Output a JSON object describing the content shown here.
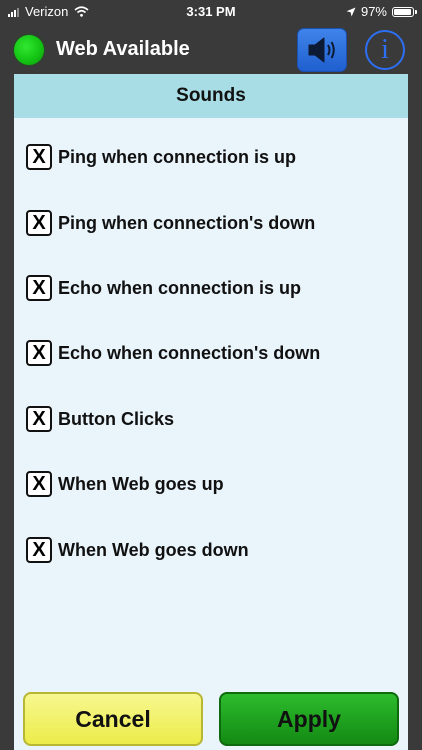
{
  "status_bar": {
    "carrier": "Verizon",
    "time": "3:31 PM",
    "battery": "97%",
    "battery_level": 0.97,
    "icons": [
      "signal-bars-icon",
      "wifi-icon",
      "location-arrow-icon",
      "battery-icon"
    ]
  },
  "header": {
    "title": "Web Available",
    "status_color": "#1ed51e",
    "sound_icon": "speaker-icon",
    "info_label": "i"
  },
  "panel": {
    "title": "Sounds",
    "options": [
      {
        "label": "Ping when connection is up",
        "checked": true,
        "mark": "X"
      },
      {
        "label": "Ping when connection's down",
        "checked": true,
        "mark": "X"
      },
      {
        "label": "Echo when connection is up",
        "checked": true,
        "mark": "X"
      },
      {
        "label": "Echo when connection's down",
        "checked": true,
        "mark": "X"
      },
      {
        "label": "Button Clicks",
        "checked": true,
        "mark": "X"
      },
      {
        "label": "When Web goes up",
        "checked": true,
        "mark": "X"
      },
      {
        "label": "When Web goes down",
        "checked": true,
        "mark": "X"
      }
    ]
  },
  "buttons": {
    "cancel": "Cancel",
    "apply": "Apply"
  },
  "colors": {
    "background": "#3a3a3a",
    "panel": "#e9f4fb",
    "panel_header": "#a8dde6",
    "cancel": "#ecec4a",
    "apply": "#1a9e1a",
    "accent": "#2d6ff2"
  }
}
